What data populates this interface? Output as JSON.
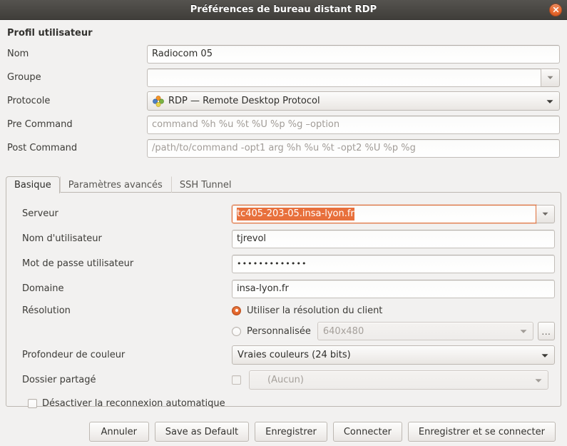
{
  "window": {
    "title": "Préférences de bureau distant RDP",
    "close_icon": "close-icon",
    "accent_color": "#e2652b",
    "titlebar_color": "#4a4844",
    "background_color": "#f2f1f0"
  },
  "profile": {
    "section_title": "Profil utilisateur",
    "name": {
      "label": "Nom",
      "value": "Radiocom 05"
    },
    "group": {
      "label": "Groupe",
      "value": ""
    },
    "protocol": {
      "label": "Protocole",
      "value": "RDP — Remote Desktop Protocol",
      "icon": "remmina-protocol-icon"
    },
    "pre_command": {
      "label": "Pre Command",
      "value": "",
      "placeholder": "command %h %u %t %U %p %g –option"
    },
    "post_command": {
      "label": "Post Command",
      "value": "",
      "placeholder": "/path/to/command -opt1 arg %h %u %t -opt2 %U %p %g"
    }
  },
  "tabs": [
    {
      "label": "Basique",
      "active": true
    },
    {
      "label": "Paramètres avancés",
      "active": false
    },
    {
      "label": "SSH Tunnel",
      "active": false
    }
  ],
  "basic": {
    "server": {
      "label": "Serveur",
      "value": "tc405-203-05.insa-lyon.fr",
      "focused": true,
      "selected": true
    },
    "username": {
      "label": "Nom d'utilisateur",
      "value": "tjrevol"
    },
    "password": {
      "label": "Mot de passe utilisateur",
      "value": "•••••••••••••",
      "masked": true
    },
    "domain": {
      "label": "Domaine",
      "value": "insa-lyon.fr"
    },
    "resolution": {
      "label": "Résolution",
      "option_client": {
        "label": "Utiliser la résolution du client",
        "selected": true
      },
      "option_custom": {
        "label": "Personnalisée",
        "selected": false
      },
      "custom_value": "640x480",
      "browse_button": "...",
      "custom_disabled": true
    },
    "color_depth": {
      "label": "Profondeur de couleur",
      "value": "Vraies couleurs (24 bits)"
    },
    "shared_folder": {
      "label": "Dossier partagé",
      "value": "(Aucun)",
      "checked": false,
      "disabled": true
    },
    "disable_autoreconnect": {
      "label": "Désactiver la reconnexion automatique",
      "checked": false
    }
  },
  "buttons": [
    {
      "label": "Annuler",
      "name": "cancel-button"
    },
    {
      "label": "Save as Default",
      "name": "save-as-default-button"
    },
    {
      "label": "Enregistrer",
      "name": "save-button"
    },
    {
      "label": "Connecter",
      "name": "connect-button"
    },
    {
      "label": "Enregistrer et se connecter",
      "name": "save-and-connect-button"
    }
  ]
}
